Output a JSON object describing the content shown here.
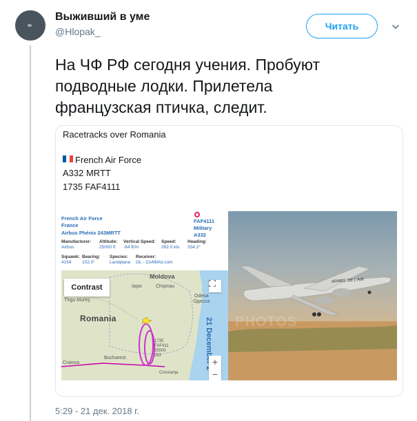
{
  "author": {
    "display_name": "Выживший в уме",
    "handle": "@Hlopak_"
  },
  "follow_button": {
    "label": "Читать"
  },
  "tweet": {
    "text": "На ЧФ РФ сегодня учения. Пробуют подводные лодки. Прилетела французская птичка, следит.",
    "timestamp": "5:29 - 21 дек. 2018 г."
  },
  "card": {
    "title": "Racetracks over Romania",
    "line1": "French Air Force",
    "line2": "A332 MRTT",
    "line3": "1735 FAF4111"
  },
  "flight_info": {
    "owner": "French Air Force",
    "country": "France",
    "aircraft": "Airbus Phénix 243MRTT",
    "right_code": "FAF4111",
    "right_type": "Military",
    "right_model": "A332",
    "labels": {
      "manufacturer": "Manufacturer:",
      "altitude": "Altitude:",
      "vertical_speed": "Vertical Speed:",
      "speed": "Speed:",
      "heading": "Heading:",
      "squawk": "Squawk:",
      "bearing": "Bearing:",
      "species": "Species:",
      "receiver": "Receiver:"
    },
    "values": {
      "manufacturer": "Airbus",
      "altitude": "25000 ft",
      "vertical_speed": "-64 ft/m",
      "speed": "392.0 kts",
      "heading": "334.2°",
      "squawk": "4154",
      "bearing": "102.0°",
      "species": "Landplane",
      "receiver": "GL - CivMilAir.com"
    }
  },
  "map": {
    "contrast_label": "Contrast",
    "labels": {
      "moldova": "Moldova",
      "iasi": "Iaşio",
      "chisinau": "Chişinau",
      "odesa": "Odesa",
      "odessa": "Одесса",
      "targu_mures": "Tîrgu Mureş",
      "romania": "Romania",
      "bucharest": "Bucharest",
      "craiova": "Craiova",
      "constanta": "Constanţa",
      "plane_label": "1735\nFAF411\n25000\n393"
    },
    "date_overlay": "21 December 2",
    "zoom_in": "+",
    "zoom_out": "−"
  },
  "photo": {
    "watermark": "PHOTOS",
    "fuselage_text": "ARMEE DE L'AIR"
  },
  "colors": {
    "accent": "#1da1f2",
    "secondary_text": "#657786",
    "track": "#cc33cc",
    "route_line": "#cc00aa"
  }
}
